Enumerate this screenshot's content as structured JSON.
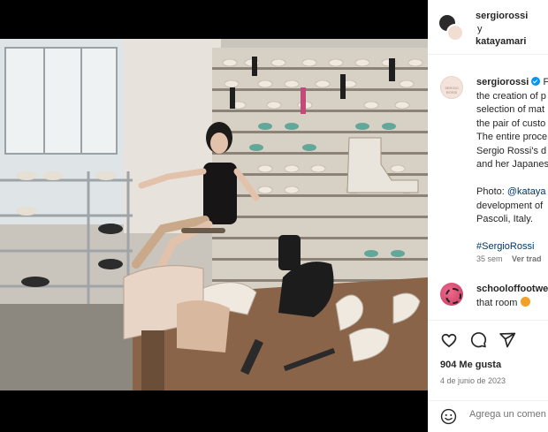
{
  "post": {
    "header": {
      "user1": "sergiorossi",
      "conj": "y",
      "user2": "katayamari"
    },
    "caption": {
      "username": "sergiorossi",
      "first_word": "F",
      "lines": [
        "the creation of p",
        "selection of mat",
        "the pair of custo",
        "The entire proce",
        "Sergio Rossi's d",
        "and her Japanes"
      ],
      "photo_prefix": "Photo:",
      "photo_tag": "@kataya",
      "lines2": [
        "development of",
        "Pascoli, Italy."
      ],
      "hashtag": "#SergioRossi",
      "age": "35 sem",
      "reply": "Ver trad"
    },
    "comment": {
      "username": "schooloffootwe",
      "text": "that room"
    },
    "likes": "904 Me gusta",
    "date": "4 de junio de 2023",
    "add_comment_placeholder": "Agrega un comen"
  },
  "icons": [
    "like-icon",
    "comment-icon",
    "share-icon",
    "emoji-icon"
  ],
  "colors": {
    "blue": "#0095f6",
    "link": "#00376b",
    "muted": "#737373",
    "text": "#262626"
  }
}
